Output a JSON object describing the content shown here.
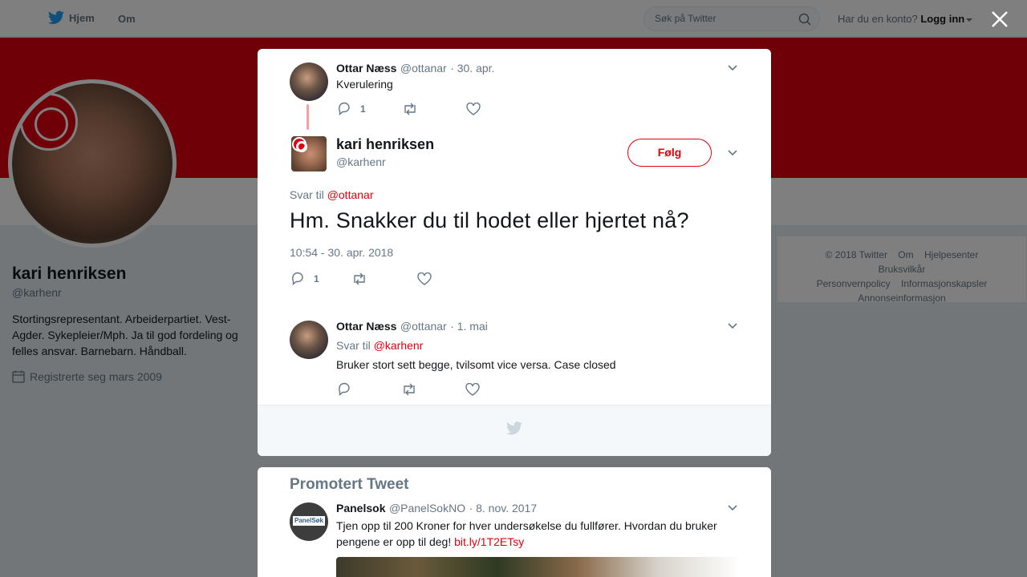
{
  "nav": {
    "home_label": "Hjem",
    "about_label": "Om",
    "search_placeholder": "Søk på Twitter",
    "account_prompt": "Har du en konto?",
    "login_label": "Logg inn"
  },
  "profile": {
    "name": "kari henriksen",
    "handle": "@karhenr",
    "bio": "Stortingsrepresentant. Arbeiderpartiet. Vest-Agder. Sykepleier/Mph. Ja til god fordeling og felles ansvar. Barnebarn. Håndball.",
    "joined": "Registrerte seg mars 2009"
  },
  "footer": {
    "links": [
      "© 2018 Twitter",
      "Om",
      "Hjelpesenter",
      "Bruksvilkår",
      "Personvernpolicy",
      "Informasjonskapsler",
      "Annonseinformasjon"
    ]
  },
  "modal": {
    "parent_tweet": {
      "name": "Ottar Næss",
      "handle": "@ottanar",
      "date": "· 30. apr.",
      "text": "Kverulering",
      "reply_count": "1"
    },
    "main_tweet": {
      "name": "kari henriksen",
      "handle": "@karhenr",
      "follow_label": "Følg",
      "reply_prefix": "Svar til",
      "reply_to": "@ottanar",
      "text": "Hm. Snakker du til hodet eller hjertet nå?",
      "timestamp": "10:54 - 30. apr. 2018",
      "reply_count": "1"
    },
    "reply_tweet": {
      "name": "Ottar Næss",
      "handle": "@ottanar",
      "date": "· 1. mai",
      "reply_prefix": "Svar til",
      "reply_to": "@karhenr",
      "text": "Bruker stort sett begge, tvilsomt vice versa. Case closed"
    }
  },
  "promoted": {
    "title": "Promotert Tweet",
    "name": "Panelsok",
    "handle": "@PanelSokNO",
    "date": "· 8. nov. 2017",
    "text": "Tjen opp til 200 Kroner for hver undersøkelse du fullfører. Hvordan du bruker pengene er opp til deg!",
    "link": "bit.ly/1T2ETsy",
    "avatar_label": "PanelSøk"
  },
  "colors": {
    "accent": "#e0000f",
    "twitter_blue": "#1da1f2",
    "muted": "#657786"
  }
}
